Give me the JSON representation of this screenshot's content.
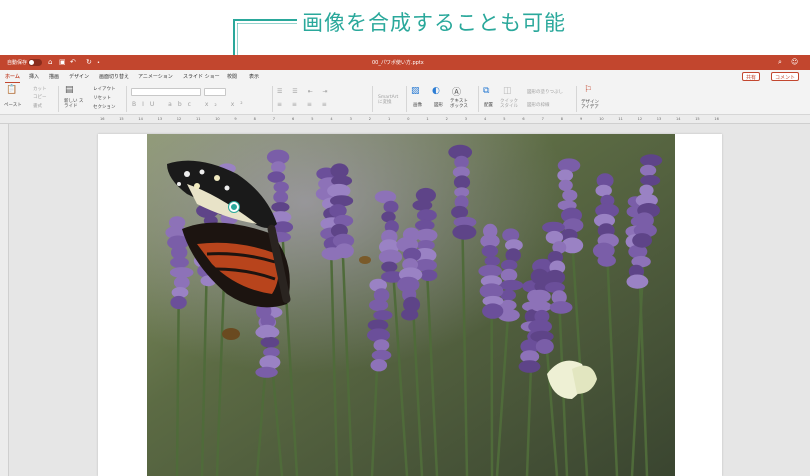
{
  "callout": {
    "text": "画像を合成することも可能"
  },
  "titlebar": {
    "autosave": "自動保存",
    "toggle_state": "オフ",
    "file_name": "00_パワポ使い方.pptx",
    "accent": "#c2462e"
  },
  "tabs": [
    "ホーム",
    "挿入",
    "描画",
    "デザイン",
    "画面切り替え",
    "アニメーション",
    "スライド ショー",
    "校閲",
    "表示"
  ],
  "share": {
    "share": "共有",
    "comment": "コメント"
  },
  "ribbon": {
    "paste": "ペースト",
    "cut": "カット",
    "copy": "コピー",
    "format": "書式",
    "new_slide": "新しい スライド",
    "layout": "レイアウト",
    "reset": "リセット",
    "section": "セクション",
    "smartart": "SmartArt に変換",
    "image": "画像",
    "shape": "図形",
    "textbox": "テキスト ボックス",
    "arrange": "配置",
    "quick_style": "クイック スタイル",
    "fill": "図形の塗りつぶし",
    "outline": "図形の枠線",
    "designer": "デザイン アイデア"
  },
  "ruler": {
    "ticks": [
      "16",
      "15",
      "14",
      "13",
      "12",
      "11",
      "10",
      "9",
      "8",
      "7",
      "6",
      "5",
      "4",
      "3",
      "2",
      "1",
      "0",
      "1",
      "2",
      "3",
      "4",
      "5",
      "6",
      "7",
      "8",
      "9",
      "10",
      "11",
      "12",
      "13",
      "14",
      "15",
      "16"
    ]
  },
  "icons": [
    "home-icon",
    "save-icon",
    "undo-icon",
    "redo-icon",
    "search-icon",
    "smiley-icon"
  ]
}
